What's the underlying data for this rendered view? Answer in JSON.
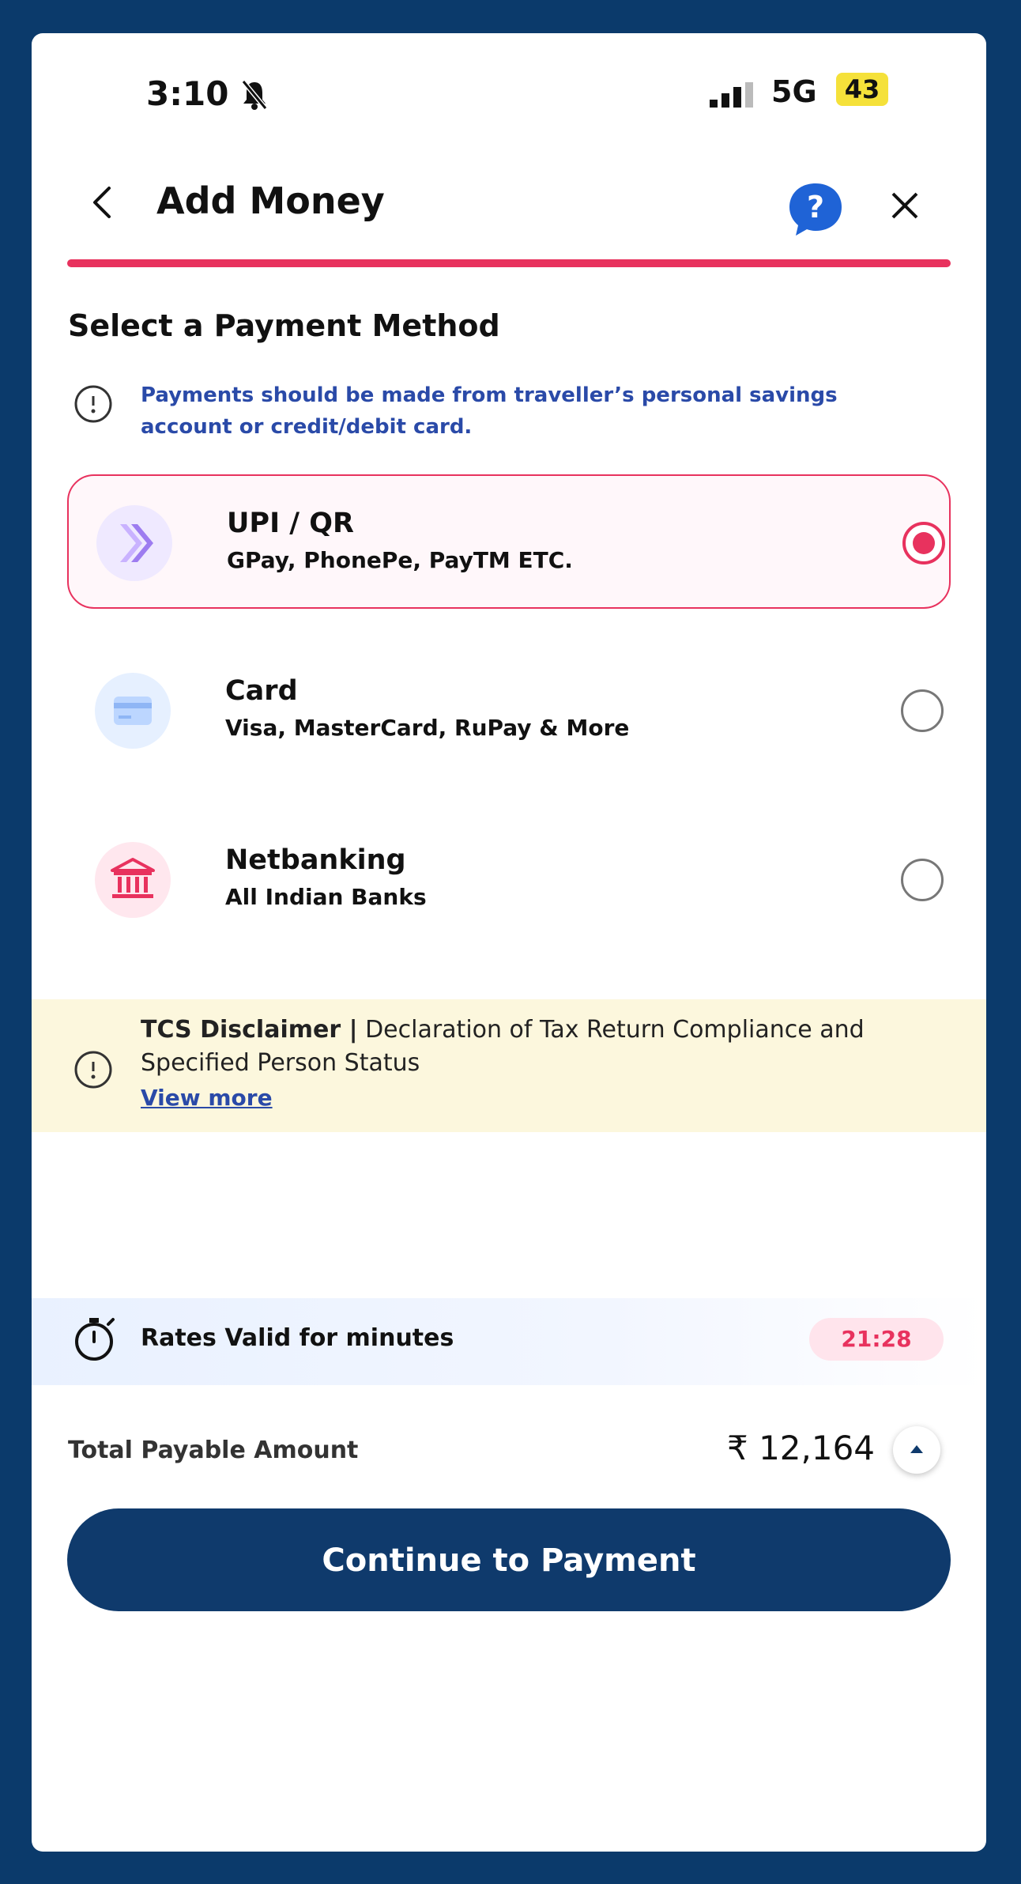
{
  "status_bar": {
    "time": "3:10",
    "network": "5G",
    "battery": "43"
  },
  "header": {
    "title": "Add Money"
  },
  "section_title": "Select a Payment Method",
  "info_note": "Payments should be made from traveller’s personal savings account or credit/debit card.",
  "payment_methods": [
    {
      "title": "UPI / QR",
      "subtitle": "GPay, PhonePe, PayTM ETC.",
      "icon": "upi-icon",
      "selected": true
    },
    {
      "title": "Card",
      "subtitle": "Visa, MasterCard, RuPay & More",
      "icon": "card-icon",
      "selected": false
    },
    {
      "title": "Netbanking",
      "subtitle": "All Indian Banks",
      "icon": "bank-icon",
      "selected": false
    }
  ],
  "disclaimer": {
    "title": "TCS Disclaimer |",
    "text": " Declaration of Tax Return Compliance and Specified Person Status",
    "link": "View more"
  },
  "rates": {
    "label": "Rates Valid for minutes",
    "countdown": "21:28"
  },
  "total": {
    "label": "Total Payable Amount",
    "amount": "₹ 12,164"
  },
  "cta": {
    "label": "Continue to Payment"
  },
  "colors": {
    "accent": "#e8325e",
    "primary": "#0f3a6c",
    "link": "#2a4aa8",
    "disclaimer_bg": "#fcf7dd"
  }
}
